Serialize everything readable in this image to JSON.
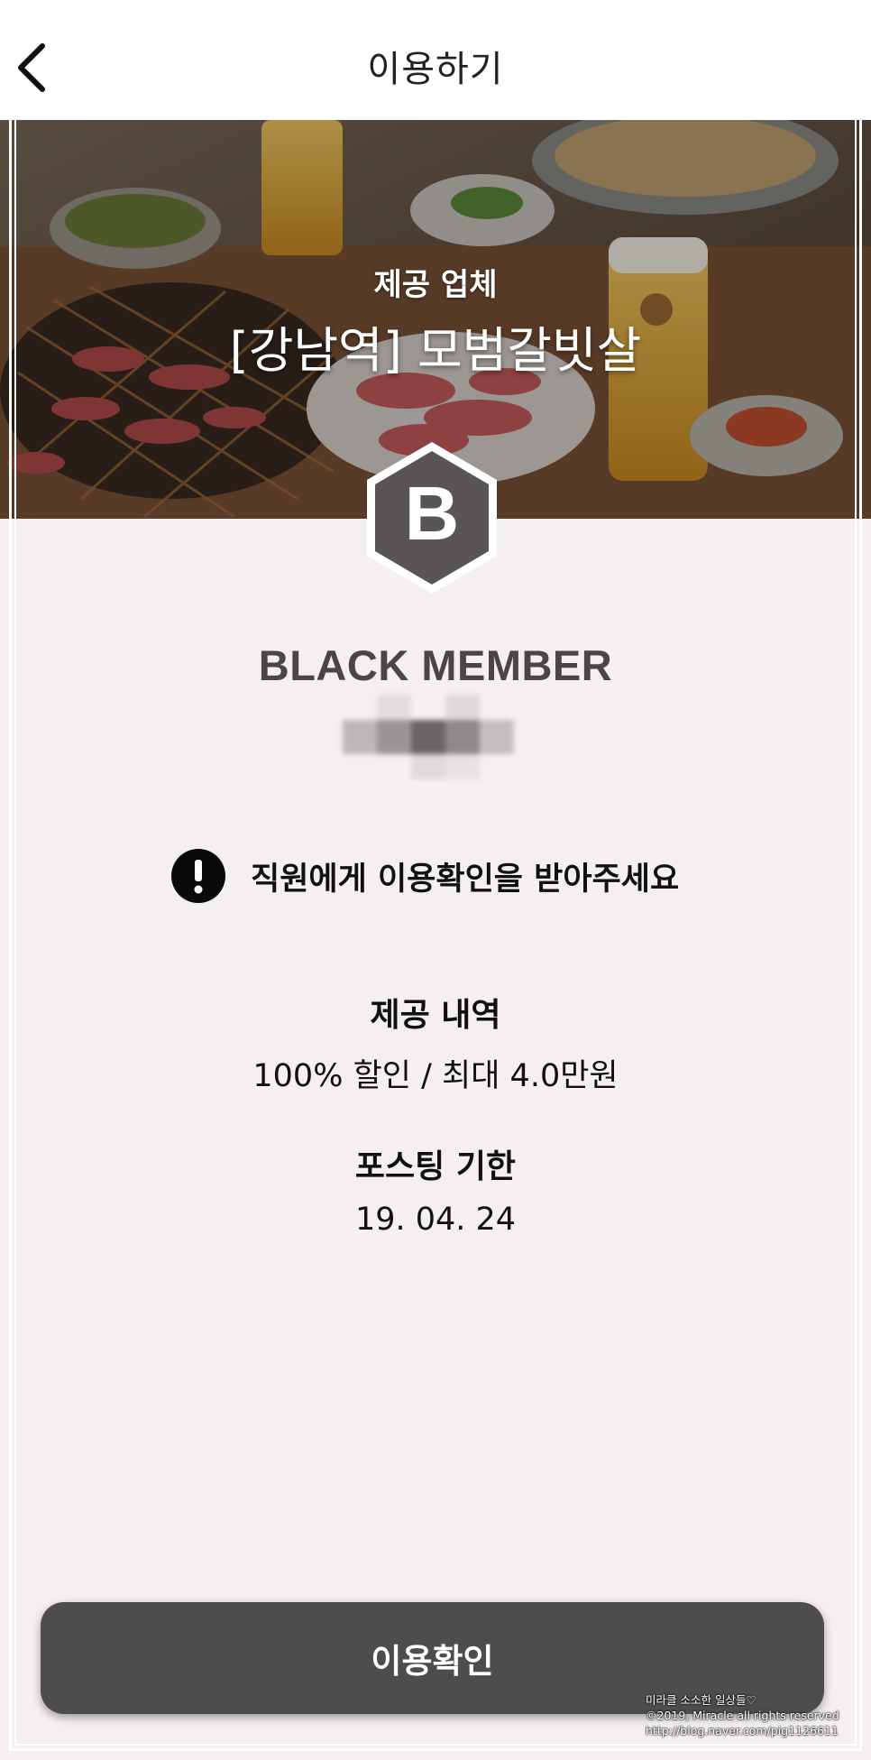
{
  "header": {
    "title": "이용하기",
    "back_icon": "chevron-left-icon"
  },
  "hero": {
    "subtitle": "제공 업체",
    "title": "[강남역] 모범갈빗살"
  },
  "badge": {
    "letter": "B",
    "color": "#5a5555"
  },
  "member": {
    "title": "BLACK MEMBER"
  },
  "notice": {
    "icon": "exclamation-circle-icon",
    "text": "직원에게 이용확인을 받아주세요"
  },
  "offer": {
    "label": "제공 내역",
    "value": "100% 할인 / 최대 4.0만원"
  },
  "posting": {
    "label": "포스팅 기한",
    "value": "19. 04. 24"
  },
  "confirm_button": {
    "label": "이용확인",
    "color": "#4e4c4c"
  },
  "watermark": {
    "line1": "미라클 소소한 일상들♡",
    "line2": "©2019, Miracle all rights reserved",
    "line3": "http://blog.naver.com/pig1126611"
  }
}
